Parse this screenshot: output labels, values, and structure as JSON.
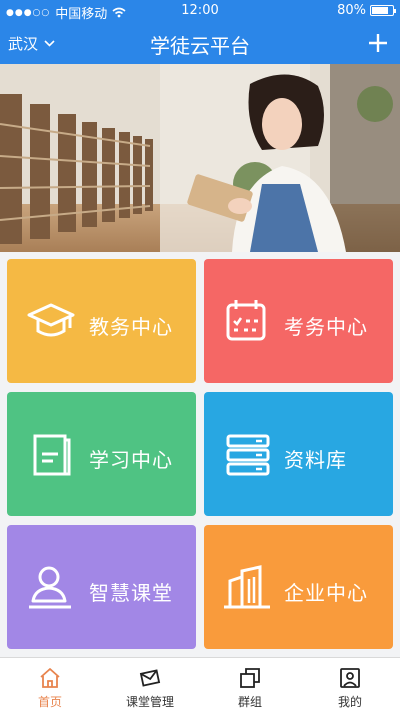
{
  "status_bar": {
    "carrier": "中国移动",
    "time": "12:00",
    "battery": "80%"
  },
  "header": {
    "city": "武汉",
    "title": "学徒云平台"
  },
  "tiles": [
    {
      "label": "教务中心",
      "icon": "graduation-cap-icon",
      "color": "#f5b944"
    },
    {
      "label": "考务中心",
      "icon": "calendar-icon",
      "color": "#f56765"
    },
    {
      "label": "学习中心",
      "icon": "book-icon",
      "color": "#4fc383"
    },
    {
      "label": "资料库",
      "icon": "database-icon",
      "color": "#28a7e2"
    },
    {
      "label": "智慧课堂",
      "icon": "user-icon",
      "color": "#a287e6"
    },
    {
      "label": "企业中心",
      "icon": "building-icon",
      "color": "#f99b3c"
    }
  ],
  "tabs": [
    {
      "label": "首页",
      "icon": "home-icon",
      "active": true
    },
    {
      "label": "课堂管理",
      "icon": "mail-icon",
      "active": false
    },
    {
      "label": "群组",
      "icon": "group-icon",
      "active": false
    },
    {
      "label": "我的",
      "icon": "profile-icon",
      "active": false
    }
  ],
  "colors": {
    "primary": "#2b86e8",
    "active_tab": "#e8844e"
  }
}
